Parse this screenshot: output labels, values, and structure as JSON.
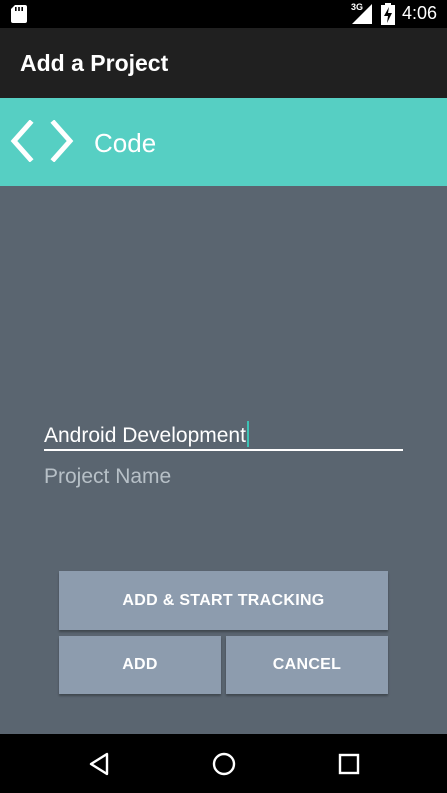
{
  "status_bar": {
    "network_type": "3G",
    "time": "4:06",
    "icons": [
      "sd-card-icon",
      "signal-icon",
      "battery-charging-icon"
    ]
  },
  "action_bar": {
    "title": "Add a Project"
  },
  "category": {
    "icon": "code-brackets-icon",
    "label": "Code",
    "color": "#56cfc3"
  },
  "form": {
    "project_name_value": "Android Development",
    "project_name_hint": "Project Name"
  },
  "buttons": {
    "add_and_start": "ADD & START TRACKING",
    "add": "ADD",
    "cancel": "CANCEL"
  },
  "nav_bar": {
    "icons": [
      "back-icon",
      "home-icon",
      "recents-icon"
    ]
  },
  "colors": {
    "background": "#5a6570",
    "action_bar": "#202020",
    "button": "#8d9cae",
    "accent": "#3cc2b5"
  }
}
